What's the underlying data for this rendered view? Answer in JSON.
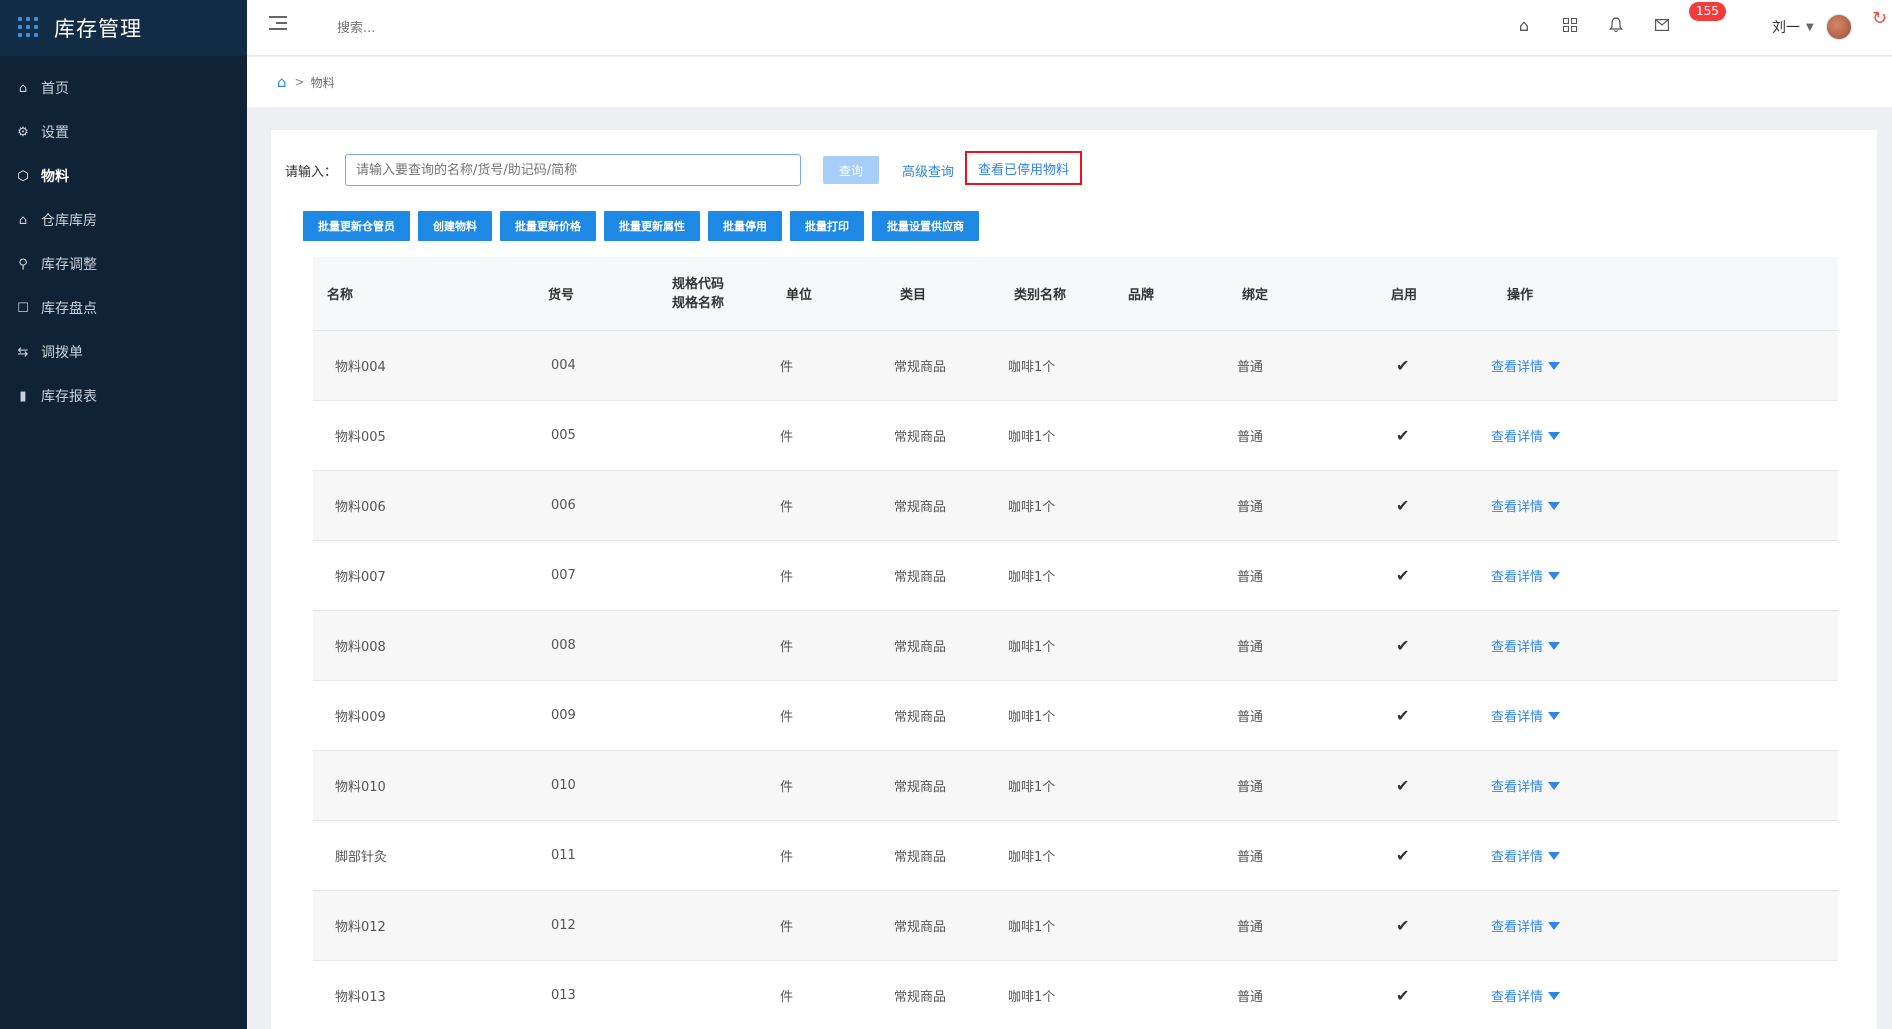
{
  "app": {
    "title": "库存管理"
  },
  "sidebar": {
    "items": [
      {
        "label": "首页",
        "icon": "home-icon",
        "active": false
      },
      {
        "label": "设置",
        "icon": "gear-icon",
        "active": false
      },
      {
        "label": "物料",
        "icon": "box-icon",
        "active": true
      },
      {
        "label": "仓库库房",
        "icon": "warehouse-icon",
        "active": false
      },
      {
        "label": "库存调整",
        "icon": "adjust-icon",
        "active": false
      },
      {
        "label": "库存盘点",
        "icon": "inventory-check-icon",
        "active": false
      },
      {
        "label": "调拨单",
        "icon": "transfer-icon",
        "active": false
      },
      {
        "label": "库存报表",
        "icon": "bar-chart-icon",
        "active": false
      }
    ]
  },
  "topbar": {
    "search_placeholder": "搜索...",
    "badge_count": "155",
    "user_name": "刘一"
  },
  "breadcrumb": {
    "current": "物料"
  },
  "query": {
    "label": "请输入：",
    "placeholder": "请输入要查询的名称/货号/助记码/简称",
    "query_button": "查询",
    "advanced_link": "高级查询",
    "stopped_link": "查看已停用物料"
  },
  "batch_buttons": [
    "批量更新仓管员",
    "创建物料",
    "批量更新价格",
    "批量更新属性",
    "批量停用",
    "批量打印",
    "批量设置供应商"
  ],
  "table": {
    "headers": {
      "name": "名称",
      "code": "货号",
      "spec_code": "规格代码",
      "spec_name": "规格名称",
      "unit": "单位",
      "category": "类目",
      "category_name": "类别名称",
      "brand": "品牌",
      "binding": "绑定",
      "enabled": "启用",
      "action": "操作"
    },
    "rows": [
      {
        "name": "物料004",
        "code": "004",
        "unit": "件",
        "category": "常规商品",
        "category_name": "咖啡1个",
        "binding": "普通",
        "enabled": "✔",
        "action": "查看详情"
      },
      {
        "name": "物料005",
        "code": "005",
        "unit": "件",
        "category": "常规商品",
        "category_name": "咖啡1个",
        "binding": "普通",
        "enabled": "✔",
        "action": "查看详情"
      },
      {
        "name": "物料006",
        "code": "006",
        "unit": "件",
        "category": "常规商品",
        "category_name": "咖啡1个",
        "binding": "普通",
        "enabled": "✔",
        "action": "查看详情"
      },
      {
        "name": "物料007",
        "code": "007",
        "unit": "件",
        "category": "常规商品",
        "category_name": "咖啡1个",
        "binding": "普通",
        "enabled": "✔",
        "action": "查看详情"
      },
      {
        "name": "物料008",
        "code": "008",
        "unit": "件",
        "category": "常规商品",
        "category_name": "咖啡1个",
        "binding": "普通",
        "enabled": "✔",
        "action": "查看详情"
      },
      {
        "name": "物料009",
        "code": "009",
        "unit": "件",
        "category": "常规商品",
        "category_name": "咖啡1个",
        "binding": "普通",
        "enabled": "✔",
        "action": "查看详情"
      },
      {
        "name": "物料010",
        "code": "010",
        "unit": "件",
        "category": "常规商品",
        "category_name": "咖啡1个",
        "binding": "普通",
        "enabled": "✔",
        "action": "查看详情"
      },
      {
        "name": "脚部针灸",
        "code": "011",
        "unit": "件",
        "category": "常规商品",
        "category_name": "咖啡1个",
        "binding": "普通",
        "enabled": "✔",
        "action": "查看详情"
      },
      {
        "name": "物料012",
        "code": "012",
        "unit": "件",
        "category": "常规商品",
        "category_name": "咖啡1个",
        "binding": "普通",
        "enabled": "✔",
        "action": "查看详情"
      },
      {
        "name": "物料013",
        "code": "013",
        "unit": "件",
        "category": "常规商品",
        "category_name": "咖啡1个",
        "binding": "普通",
        "enabled": "✔",
        "action": "查看详情"
      }
    ]
  }
}
